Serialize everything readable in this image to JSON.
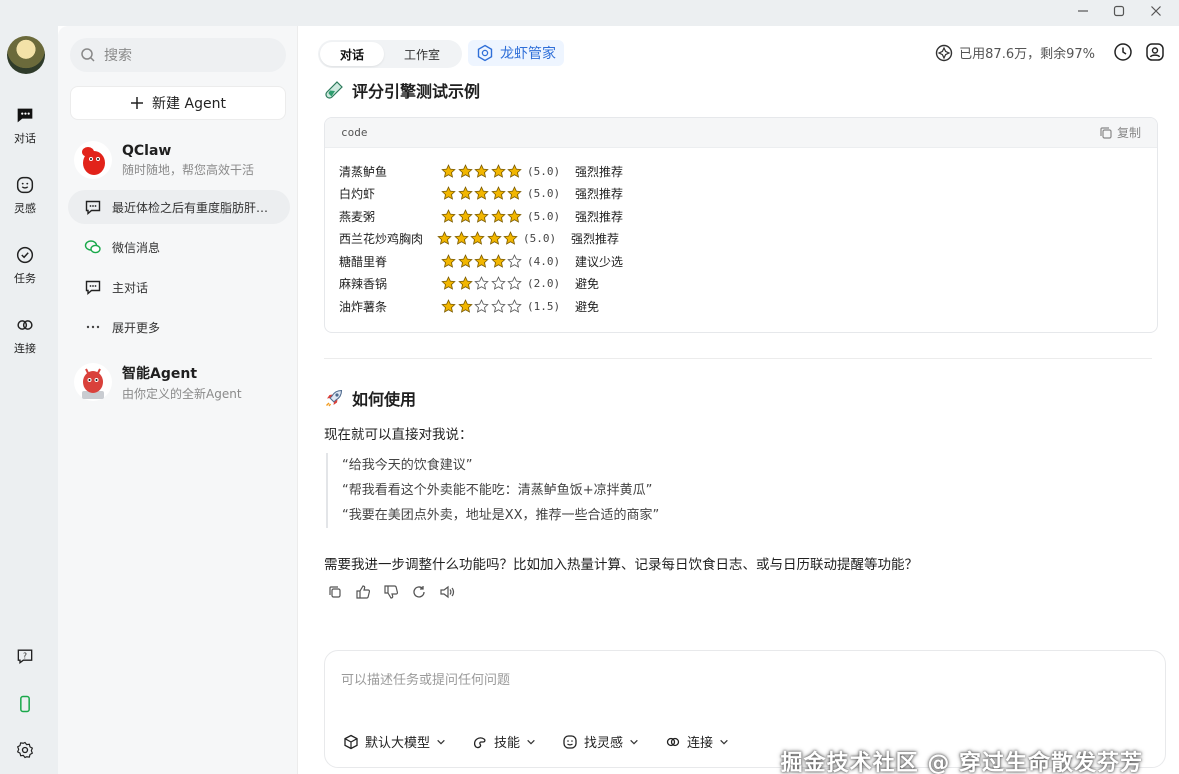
{
  "window": {
    "title": "",
    "controls": [
      "minimize-icon",
      "maximize-icon",
      "close-icon"
    ]
  },
  "rail": {
    "items": [
      {
        "label": "对话",
        "icon": "chat-icon"
      },
      {
        "label": "灵感",
        "icon": "inspiration-icon"
      },
      {
        "label": "任务",
        "icon": "task-icon"
      },
      {
        "label": "连接",
        "icon": "link-icon"
      }
    ],
    "bottom_icons": [
      "help-icon",
      "phone-icon",
      "settings-icon"
    ]
  },
  "sidebar": {
    "search_placeholder": "搜索",
    "new_agent_label": "新建 Agent",
    "agents": [
      {
        "name": "QClaw",
        "subtitle": "随时随地，帮您高效干活"
      },
      {
        "name": "智能Agent",
        "subtitle": "由你定义的全新Agent"
      }
    ],
    "conversations": [
      {
        "label": "最近体检之后有重度脂肪肝…",
        "icon": "chat-bubble-icon",
        "active": true
      },
      {
        "label": "微信消息",
        "icon": "wechat-icon",
        "active": false
      },
      {
        "label": "主对话",
        "icon": "chat-bubble-icon",
        "active": false
      },
      {
        "label": "展开更多",
        "icon": "more-icon",
        "active": false
      }
    ]
  },
  "topbar": {
    "tabs": [
      "对话",
      "工作室"
    ],
    "active_tab": "对话",
    "butler_label": "龙虾管家",
    "usage_text": "已用87.6万，剩余97%"
  },
  "content": {
    "section1_title": "评分引擎测试示例",
    "code_lang": "code",
    "copy_label": "复制",
    "ratings": [
      {
        "dish": "清蒸鲈鱼",
        "stars": 5,
        "score": "(5.0)",
        "verdict": "强烈推荐"
      },
      {
        "dish": "白灼虾",
        "stars": 5,
        "score": "(5.0)",
        "verdict": "强烈推荐"
      },
      {
        "dish": "燕麦粥",
        "stars": 5,
        "score": "(5.0)",
        "verdict": "强烈推荐"
      },
      {
        "dish": "西兰花炒鸡胸肉",
        "stars": 5,
        "score": "(5.0)",
        "verdict": "强烈推荐"
      },
      {
        "dish": "糖醋里脊",
        "stars": 4,
        "score": "(4.0)",
        "verdict": "建议少选"
      },
      {
        "dish": "麻辣香锅",
        "stars": 2,
        "score": "(2.0)",
        "verdict": "避免"
      },
      {
        "dish": "油炸薯条",
        "stars": 2,
        "score": "(1.5)",
        "verdict": "避免"
      }
    ],
    "section2_title": "如何使用",
    "intro": "现在就可以直接对我说：",
    "quotes": [
      "“给我今天的饮食建议”",
      "“帮我看看这个外卖能不能吃：清蒸鲈鱼饭+凉拌黄瓜”",
      "“我要在美团点外卖，地址是XX，推荐一些合适的商家”"
    ],
    "followup": "需要我进一步调整什么功能吗？比如加入热量计算、记录每日饮食日志、或与日历联动提醒等功能？",
    "action_icons": [
      "copy-icon",
      "thumbs-up-icon",
      "thumbs-down-icon",
      "retry-icon",
      "speaker-icon"
    ]
  },
  "composer": {
    "placeholder": "可以描述任务或提问任何问题",
    "chips": [
      {
        "label": "默认大模型",
        "icon": "model-icon"
      },
      {
        "label": "技能",
        "icon": "skill-icon"
      },
      {
        "label": "找灵感",
        "icon": "inspiration-icon"
      },
      {
        "label": "连接",
        "icon": "link-icon"
      }
    ],
    "watermark": "掘金技术社区 @ 穿过生命散发芬芳"
  },
  "colors": {
    "accent": "#2f6fd8",
    "star": "#f2b600",
    "rail_bg": "#eceff1",
    "sidebar_bg": "#f6f7f8"
  }
}
